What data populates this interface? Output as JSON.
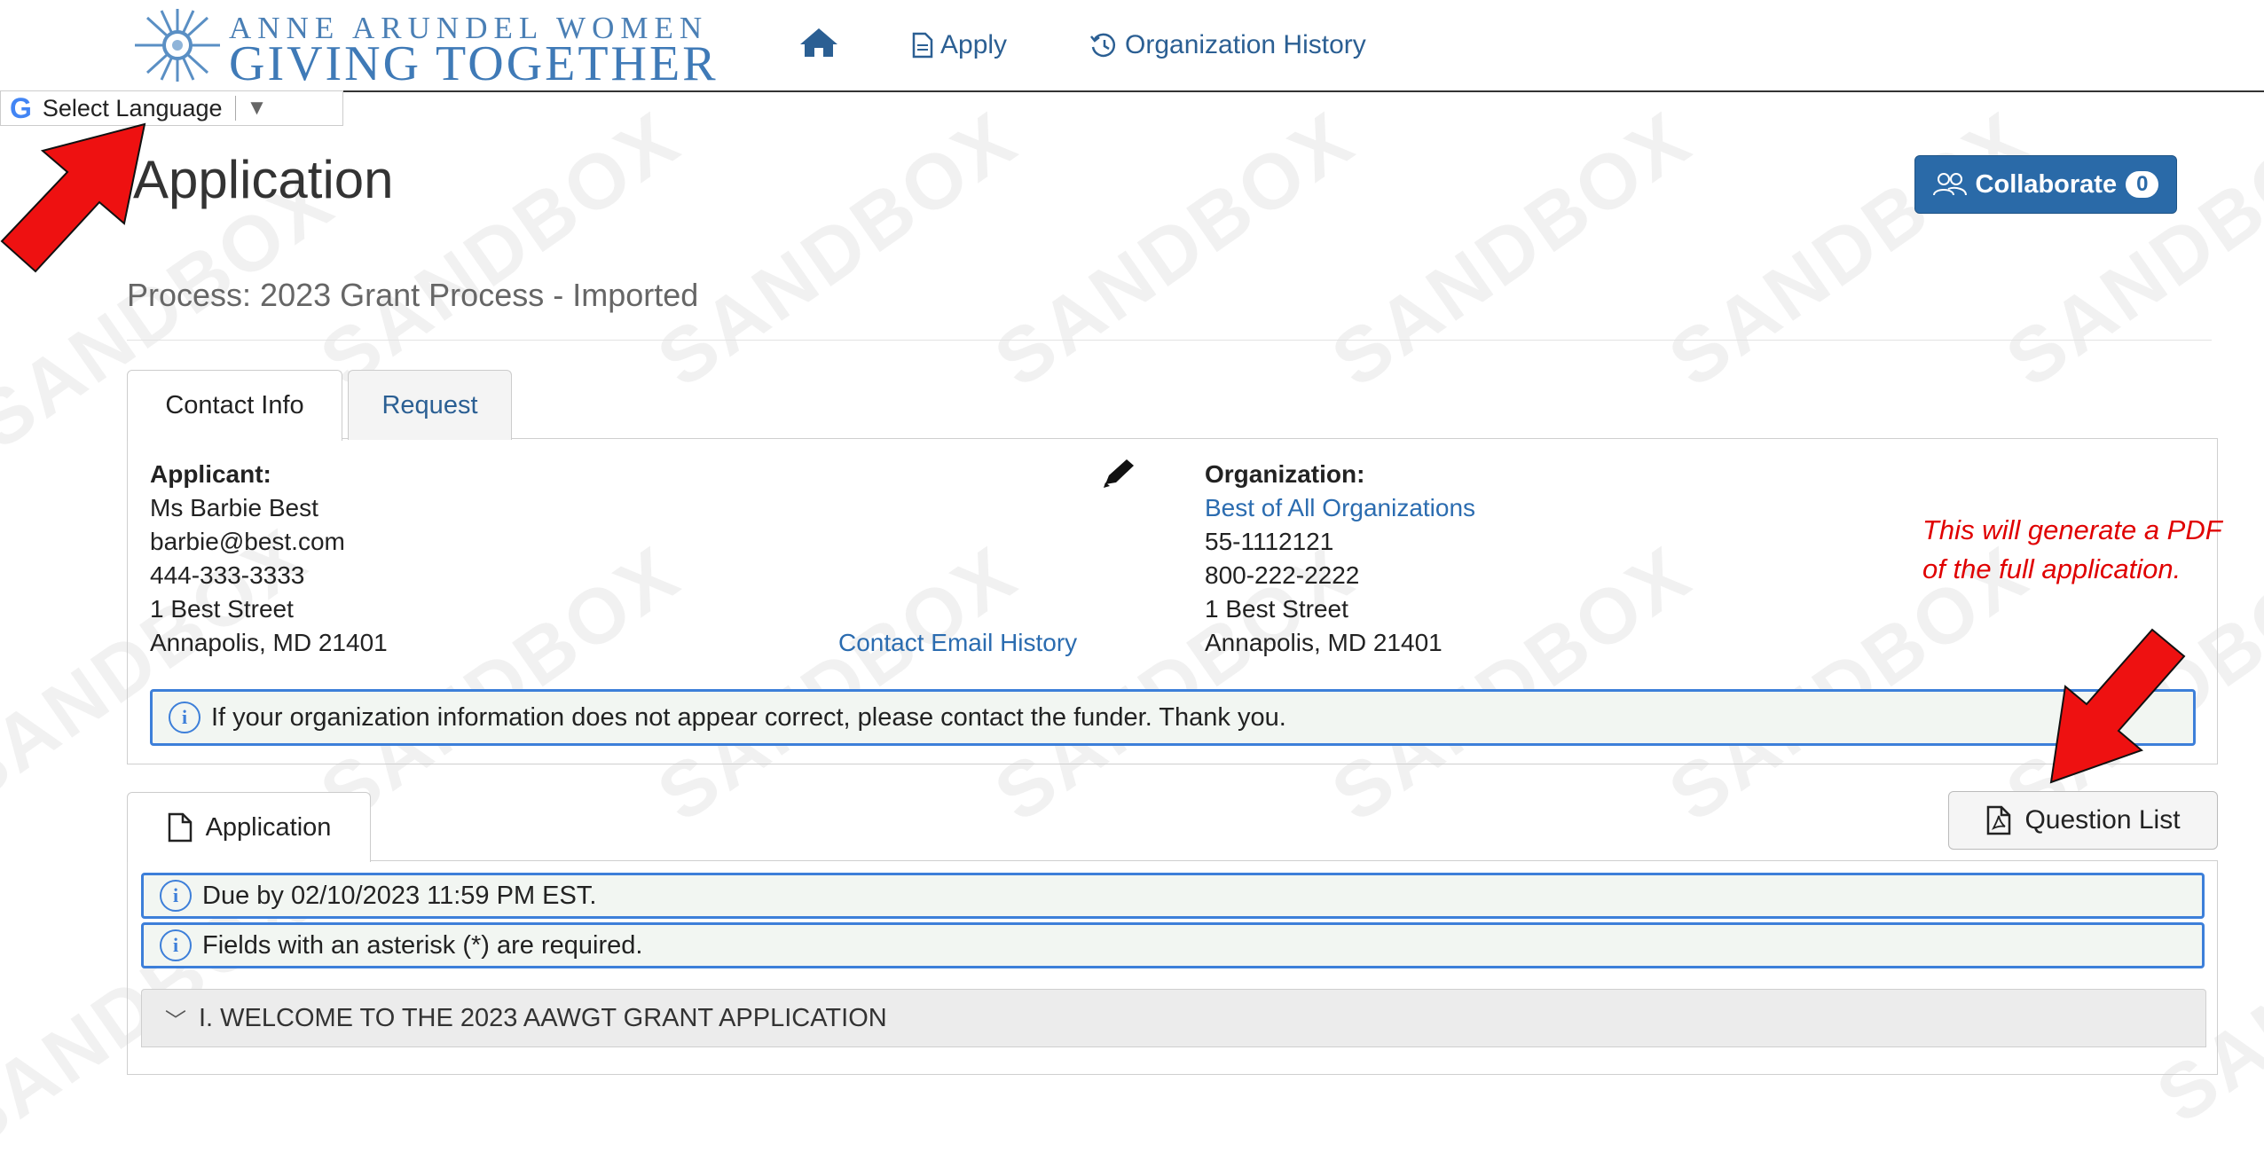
{
  "header": {
    "logo_line1": "ANNE ARUNDEL WOMEN",
    "logo_line2": "GIVING TOGETHER",
    "nav": {
      "home_icon": "home-icon",
      "apply_label": "Apply",
      "history_label": "Organization History"
    }
  },
  "language": {
    "label": "Select Language",
    "dropdown_glyph": "▼"
  },
  "watermark_text": "SANDBOX",
  "page": {
    "title": "Application",
    "process": "Process: 2023 Grant Process - Imported",
    "collaborate_label": "Collaborate",
    "collaborate_count": "0"
  },
  "tabs": {
    "contact_info": "Contact Info",
    "request": "Request"
  },
  "applicant": {
    "heading": "Applicant:",
    "name": "Ms Barbie Best",
    "email": "barbie@best.com",
    "phone": "444-333-3333",
    "street": "1 Best Street",
    "city": "Annapolis, MD 21401",
    "email_history_link": "Contact Email History"
  },
  "organization": {
    "heading": "Organization:",
    "name": "Best of All Organizations",
    "ein": "55-1112121",
    "phone": "800-222-2222",
    "street": "1 Best Street",
    "city": "Annapolis, MD 21401"
  },
  "org_notice": "If your organization information does not appear correct, please contact the funder. Thank you.",
  "annotation_note": {
    "line1": "This will generate a PDF",
    "line2": "of the full application."
  },
  "application_tab": "Application",
  "question_list_button": "Question List",
  "alerts": {
    "due": "Due by 02/10/2023 11:59 PM EST.",
    "required": "Fields with an asterisk (*) are required."
  },
  "section": {
    "chevron": "﹀",
    "title": "I. WELCOME TO THE 2023 AAWGT GRANT APPLICATION"
  },
  "colors": {
    "accent": "#2a6aa8",
    "link": "#2b6cb0",
    "annotation": "#e00000",
    "alert_border": "#3d7fd9"
  }
}
